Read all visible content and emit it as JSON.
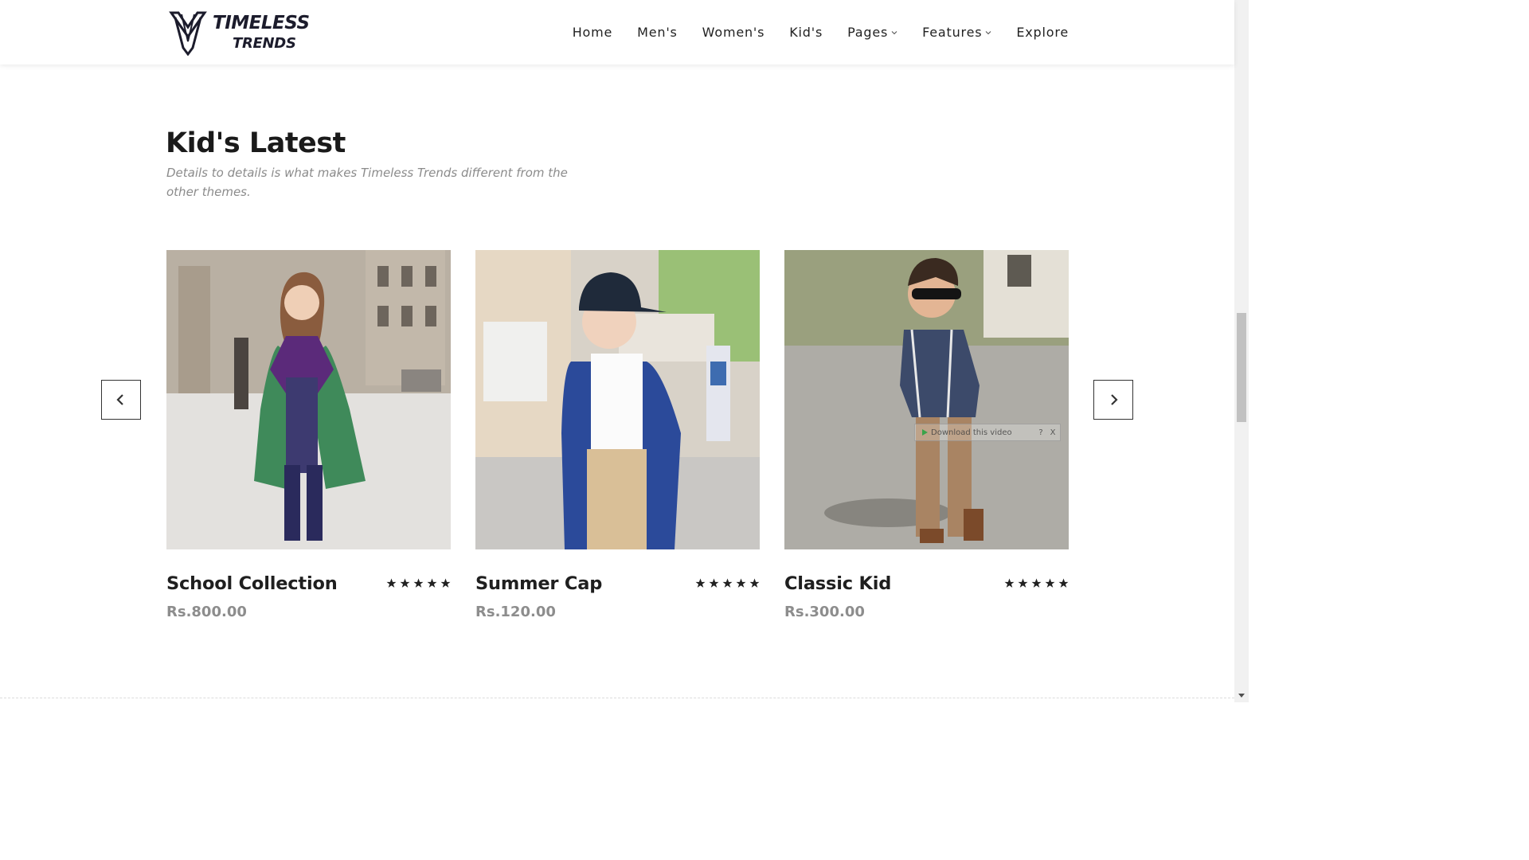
{
  "brand": {
    "line1": "TIMELESS",
    "line2": "TRENDS"
  },
  "nav": {
    "items": [
      {
        "label": "Home",
        "has_dropdown": false
      },
      {
        "label": "Men's",
        "has_dropdown": false
      },
      {
        "label": "Women's",
        "has_dropdown": false
      },
      {
        "label": "Kid's",
        "has_dropdown": false
      },
      {
        "label": "Pages",
        "has_dropdown": true
      },
      {
        "label": "Features",
        "has_dropdown": true
      },
      {
        "label": "Explore",
        "has_dropdown": false
      }
    ]
  },
  "section": {
    "title": "Kid's Latest",
    "subtitle": "Details to details is what makes Timeless Trends different from the other themes."
  },
  "products": [
    {
      "name": "School Collection",
      "price": "Rs.800.00",
      "rating": 5
    },
    {
      "name": "Summer Cap",
      "price": "Rs.120.00",
      "rating": 5
    },
    {
      "name": "Classic Kid",
      "price": "Rs.300.00",
      "rating": 5
    }
  ],
  "video_overlay": {
    "label": "Download this video",
    "help": "?",
    "close": "X"
  },
  "colors": {
    "accent": "#1c1c2c",
    "text": "#1f1f1f",
    "muted": "#8d8d8d"
  }
}
